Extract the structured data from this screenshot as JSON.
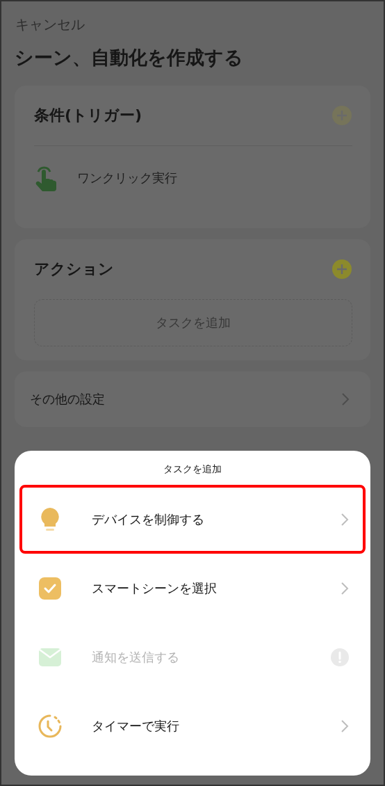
{
  "cancel": "キャンセル",
  "title": "シーン、自動化を作成する",
  "conditions": {
    "heading": "条件(トリガー)",
    "add_disabled": true,
    "items": [
      {
        "label": "ワンクリック実行"
      }
    ]
  },
  "actions": {
    "heading": "アクション",
    "add_disabled": false,
    "add_task": "タスクを追加"
  },
  "other_settings": "その他の設定",
  "sheet": {
    "title": "タスクを追加",
    "items": [
      {
        "kind": "device",
        "label": "デバイスを制御する",
        "disabled": false,
        "highlighted": true
      },
      {
        "kind": "scene",
        "label": "スマートシーンを選択",
        "disabled": false,
        "highlighted": false
      },
      {
        "kind": "notify",
        "label": "通知を送信する",
        "disabled": true,
        "highlighted": false
      },
      {
        "kind": "timer",
        "label": "タイマーで実行",
        "disabled": false,
        "highlighted": false
      }
    ]
  }
}
